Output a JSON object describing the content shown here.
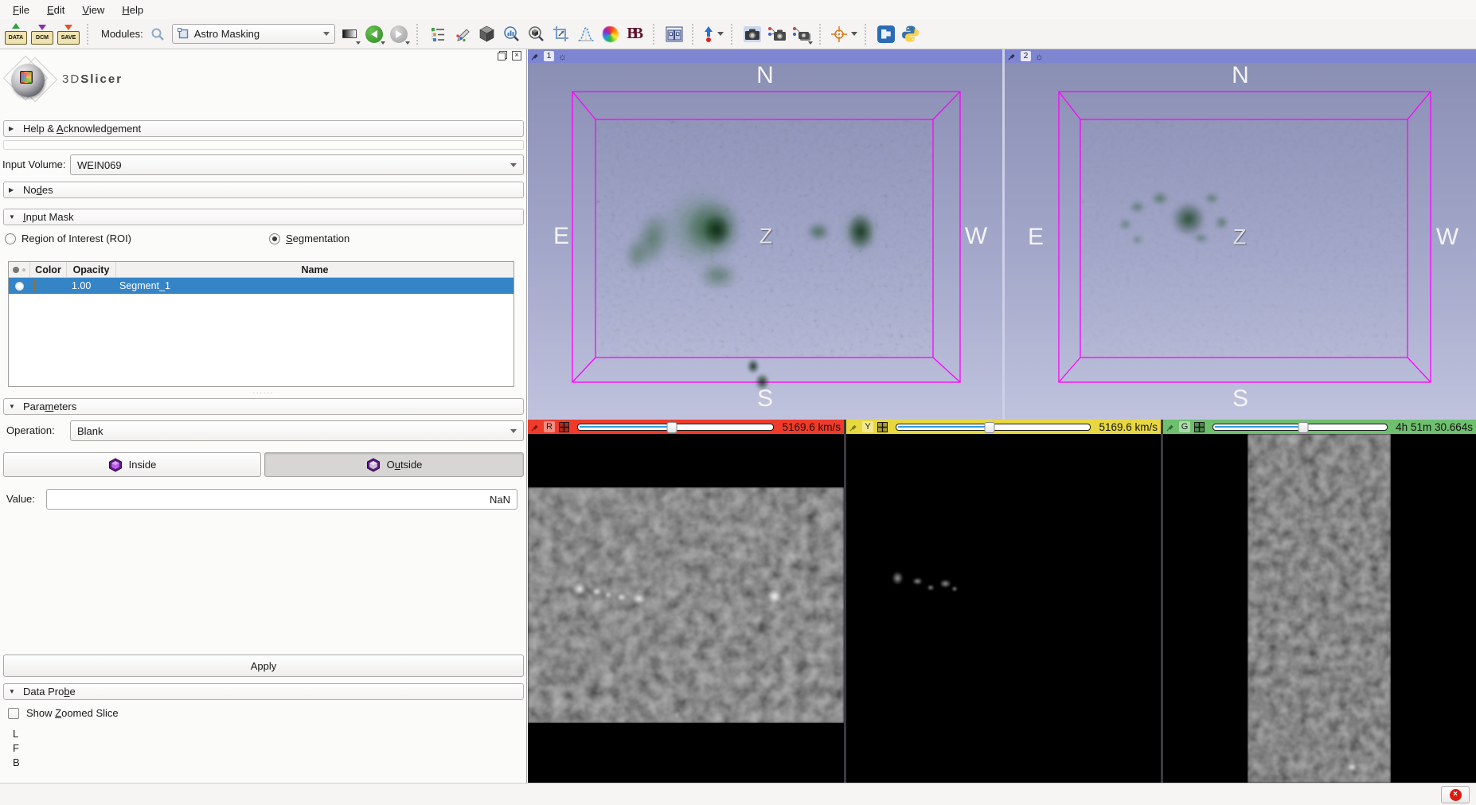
{
  "menu": {
    "items": [
      {
        "html": "<u>F</u>ile"
      },
      {
        "html": "<u>E</u>dit"
      },
      {
        "html": "<u>V</u>iew"
      },
      {
        "html": "<u>H</u>elp"
      }
    ]
  },
  "toolbar": {
    "data_label": "DATA",
    "dcm_label": "DCM",
    "save_label": "SAVE",
    "modules_label": "Modules:",
    "module_selector": "Astro Masking",
    "bb_label": "BB"
  },
  "panel": {
    "logo_3d": "3D",
    "logo_slicer": "Slicer",
    "sections": {
      "help": {
        "caret": "▶",
        "html": "Help & <u>A</u>cknowledgement"
      },
      "nodes": {
        "caret": "▶",
        "html": "No<u>d</u>es"
      },
      "input_mask": {
        "caret": "▼",
        "html": "<u>I</u>nput Mask"
      },
      "parameters": {
        "caret": "▼",
        "html": "Para<u>m</u>eters"
      },
      "data_probe": {
        "caret": "▼",
        "html": "Data Pro<u>b</u>e"
      }
    },
    "input_volume": {
      "label": "Input Volume:",
      "value": "WEIN069"
    },
    "mask": {
      "roi_html": "Re<u>g</u>ion of Interest (ROI)",
      "seg_html": "<u>S</u>egmentation",
      "selected": "Segmentation"
    },
    "segment_table": {
      "columns": {
        "color": "Color",
        "opacity": "Opacity",
        "name": "Name"
      },
      "row": {
        "opacity": "1.00",
        "name": "Segment_1",
        "color": "#c9a45f",
        "selected": true
      }
    },
    "operation": {
      "label": "Operation:",
      "value": "Blank"
    },
    "inside_label": "Inside",
    "outside_html": "O<u>u</u>tside",
    "value_field": {
      "label": "Value:",
      "value": "NaN"
    },
    "apply_label": "Apply",
    "show_zoomed_html": "Show <u>Z</u>oomed Slice",
    "probe": {
      "l": "L",
      "f": "F",
      "b": "B"
    }
  },
  "views_3d": [
    {
      "id": "1",
      "n": "N",
      "e": "E",
      "w": "W",
      "s": "S",
      "z": "Z",
      "box_color": "#ff00ff"
    },
    {
      "id": "2",
      "n": "N",
      "e": "E",
      "w": "W",
      "s": "S",
      "z": "Z",
      "box_color": "#ff00ff"
    }
  ],
  "slice_views": [
    {
      "id": "R",
      "value": "5169.6 km/s",
      "color": "#ee3b2a",
      "slider_pos": "48%"
    },
    {
      "id": "Y",
      "value": "5169.6 km/s",
      "color": "#e8d83f",
      "slider_pos": "48%"
    },
    {
      "id": "G",
      "value": "4h 51m 30.664s",
      "color": "#6ebf6e",
      "slider_pos": "52%"
    }
  ],
  "icons": {
    "sun": "☼",
    "close_x": "×",
    "dock_close_x": "×"
  }
}
